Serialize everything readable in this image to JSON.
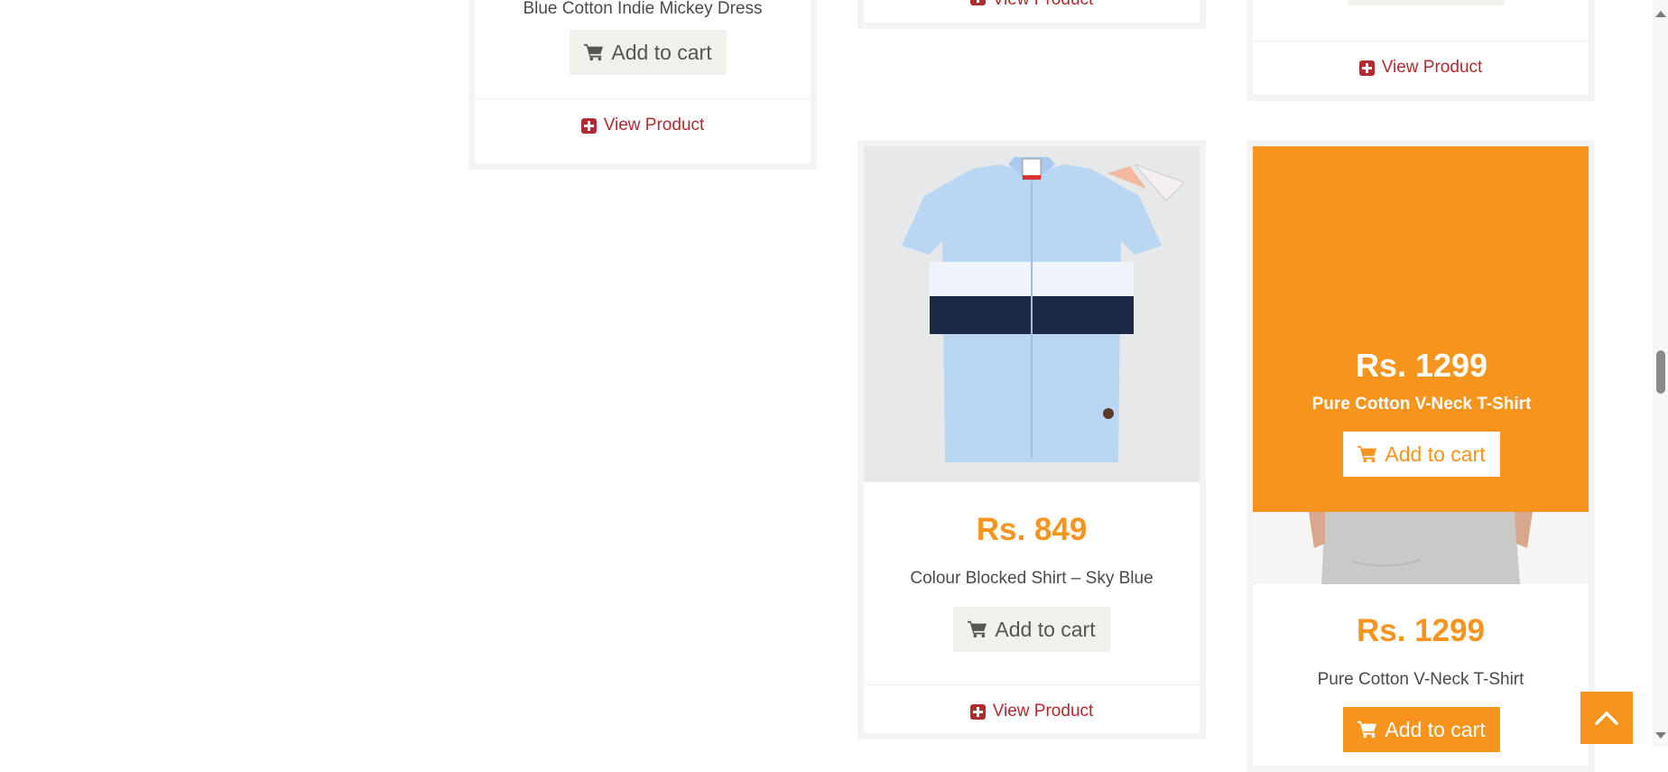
{
  "products": {
    "card_left": {
      "name": "Blue Cotton Indie Mickey Dress",
      "add_to_cart": "Add to cart",
      "view_product": "View Product"
    },
    "card_mid_top": {
      "view_product": "View Product"
    },
    "card_right_top": {
      "view_product": "View Product"
    },
    "card_shirt": {
      "price": "Rs. 849",
      "name": "Colour Blocked Shirt – Sky Blue",
      "add_to_cart": "Add to cart",
      "view_product": "View Product"
    },
    "card_tshirt": {
      "overlay_price": "Rs. 1299",
      "overlay_name": "Pure Cotton V-Neck T-Shirt",
      "overlay_add_to_cart": "Add to cart",
      "price": "Rs. 1299",
      "name": "Pure Cotton V-Neck T-Shirt",
      "add_to_cart": "Add to cart"
    }
  },
  "icons": {
    "cart": "cart-icon",
    "view": "plus-square-icon",
    "back_to_top": "chevron-up-icon"
  },
  "colors": {
    "accent": "#f7941d",
    "link": "#b02a2f",
    "button_bg": "#f1f1ec"
  }
}
